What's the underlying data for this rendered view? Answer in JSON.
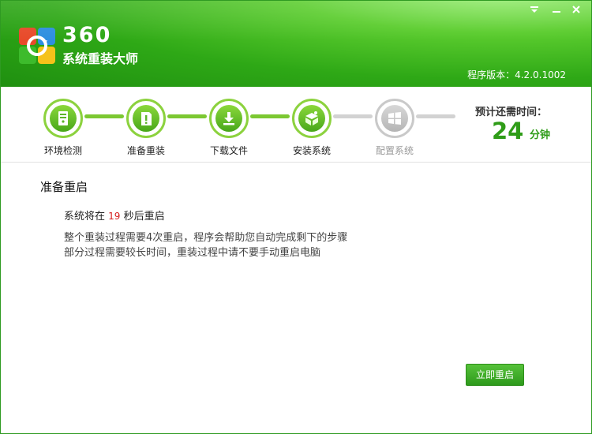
{
  "header": {
    "brand_number": "360",
    "brand_name": "系统重装大师",
    "version_label": "程序版本：",
    "version_value": "4.2.0.1002",
    "menu_icon": "menu-down-icon",
    "minimize_icon": "minimize-icon",
    "close_icon": "close-icon"
  },
  "steps": [
    {
      "label": "环境检测",
      "icon": "computer-check-icon",
      "state": "done"
    },
    {
      "label": "准备重装",
      "icon": "clipboard-exclamation-icon",
      "state": "done"
    },
    {
      "label": "下载文件",
      "icon": "download-icon",
      "state": "done"
    },
    {
      "label": "安装系统",
      "icon": "install-box-icon",
      "state": "active"
    },
    {
      "label": "配置系统",
      "icon": "windows-icon",
      "state": "pending"
    }
  ],
  "time_estimate": {
    "title": "预计还需时间：",
    "value": "24",
    "unit": "分钟"
  },
  "main": {
    "section_title": "准备重启",
    "countdown_prefix": "系统将在",
    "countdown_seconds": "19",
    "countdown_suffix": "秒后重启",
    "desc_line1": "整个重装过程需要4次重启，程序会帮助您自动完成剩下的步骤",
    "desc_line2": "部分过程需要较长时间，重装过程中请不要手动重启电脑"
  },
  "actions": {
    "restart_now_label": "立即重启"
  },
  "colors": {
    "brand_green": "#2ea816",
    "accent_green": "#2f9c18",
    "countdown_red": "#d61c1c"
  }
}
